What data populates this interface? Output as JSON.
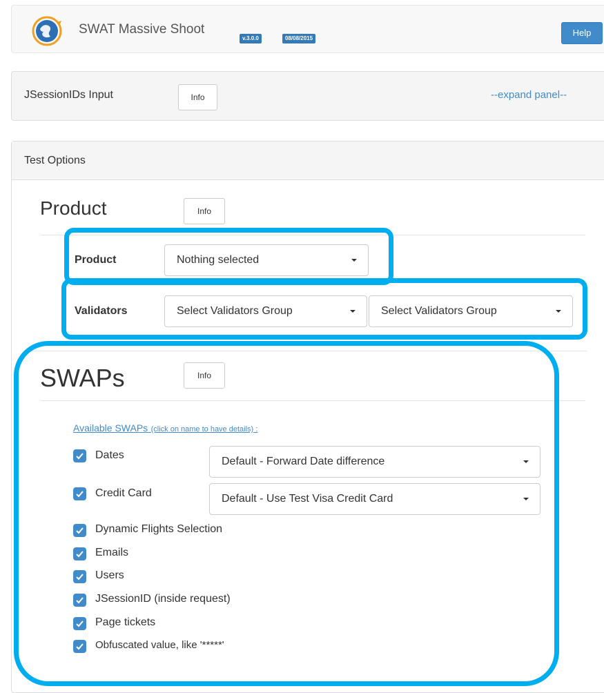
{
  "navbar": {
    "title": "SWAT Massive Shoot",
    "version": "v.3.0.0",
    "date": "08/08/2015",
    "help_label": "Help",
    "accent": "#428bca"
  },
  "jsession_panel": {
    "title": "JSessionIDs Input",
    "info_label": "Info",
    "expand_label": "--expand panel--"
  },
  "test_options": {
    "title": "Test Options",
    "product_section": {
      "heading": "Product",
      "info_label": "Info",
      "product_label": "Product",
      "product_value": "Nothing selected",
      "validators_label": "Validators",
      "validators_value_1": "Select Validators Group",
      "validators_value_2": "Select Validators Group"
    },
    "swaps_section": {
      "heading": "SWAPs",
      "info_label": "Info",
      "available_link": "Available SWAPs",
      "available_hint": "(click on name to have details) :",
      "items": [
        {
          "label": "Dates",
          "checked": true,
          "option": "Default - Forward Date difference"
        },
        {
          "label": "Credit Card",
          "checked": true,
          "option": "Default - Use Test Visa Credit Card"
        },
        {
          "label": "Dynamic Flights Selection",
          "checked": true
        },
        {
          "label": "Emails",
          "checked": true
        },
        {
          "label": "Users",
          "checked": true
        },
        {
          "label": "JSessionID (inside request)",
          "checked": true
        },
        {
          "label": "Page tickets",
          "checked": true
        },
        {
          "label": "Obfuscated value, like '*****'",
          "checked": true
        }
      ]
    }
  },
  "highlight_color": "#00adef"
}
